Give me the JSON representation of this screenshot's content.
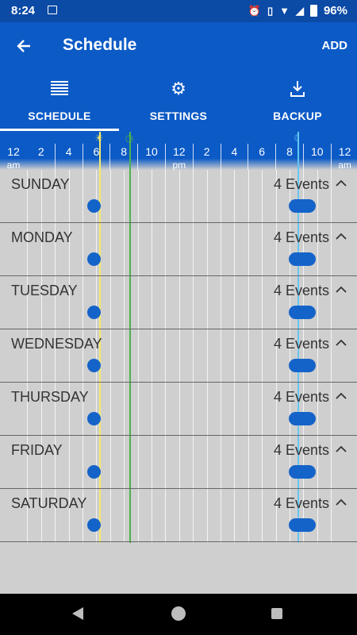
{
  "status_bar": {
    "time": "8:24",
    "battery": "96%"
  },
  "app_bar": {
    "title": "Schedule",
    "add_label": "ADD"
  },
  "tabs": [
    {
      "label": "SCHEDULE",
      "icon": "list-lines-icon",
      "selected": true
    },
    {
      "label": "SETTINGS",
      "icon": "gear-icon",
      "selected": false
    },
    {
      "label": "BACKUP",
      "icon": "download-icon",
      "selected": false
    }
  ],
  "timeline": {
    "hour_labels": [
      "12",
      "2",
      "4",
      "6",
      "8",
      "10",
      "12",
      "2",
      "4",
      "6",
      "8",
      "10",
      "12"
    ],
    "hour_sub_labels": [
      "am",
      "",
      "",
      "",
      "",
      "",
      "pm",
      "",
      "",
      "",
      "",
      "",
      "am"
    ],
    "markers": [
      {
        "name": "sunrise",
        "hour": 6.2,
        "color": "#f5e96b",
        "icon": "sun-icon"
      },
      {
        "name": "now",
        "hour": 8.4,
        "color": "#4db24d",
        "icon": "clock-icon"
      },
      {
        "name": "sunset",
        "hour": 20.6,
        "color": "#64c7f2",
        "icon": "moon-icon"
      }
    ]
  },
  "days": [
    {
      "name": "SUNDAY",
      "events_label": "4 Events"
    },
    {
      "name": "MONDAY",
      "events_label": "4 Events"
    },
    {
      "name": "TUESDAY",
      "events_label": "4 Events"
    },
    {
      "name": "WEDNESDAY",
      "events_label": "4 Events"
    },
    {
      "name": "THURSDAY",
      "events_label": "4 Events"
    },
    {
      "name": "FRIDAY",
      "events_label": "4 Events"
    },
    {
      "name": "SATURDAY",
      "events_label": "4 Events"
    }
  ],
  "event_marks": [
    {
      "shape": "dot",
      "hour": 5.8
    },
    {
      "shape": "pill",
      "hour": 20.9
    }
  ],
  "colors": {
    "accent": "#0b5ac6",
    "event": "#1463c9",
    "row_background": "#cfcfcf"
  }
}
